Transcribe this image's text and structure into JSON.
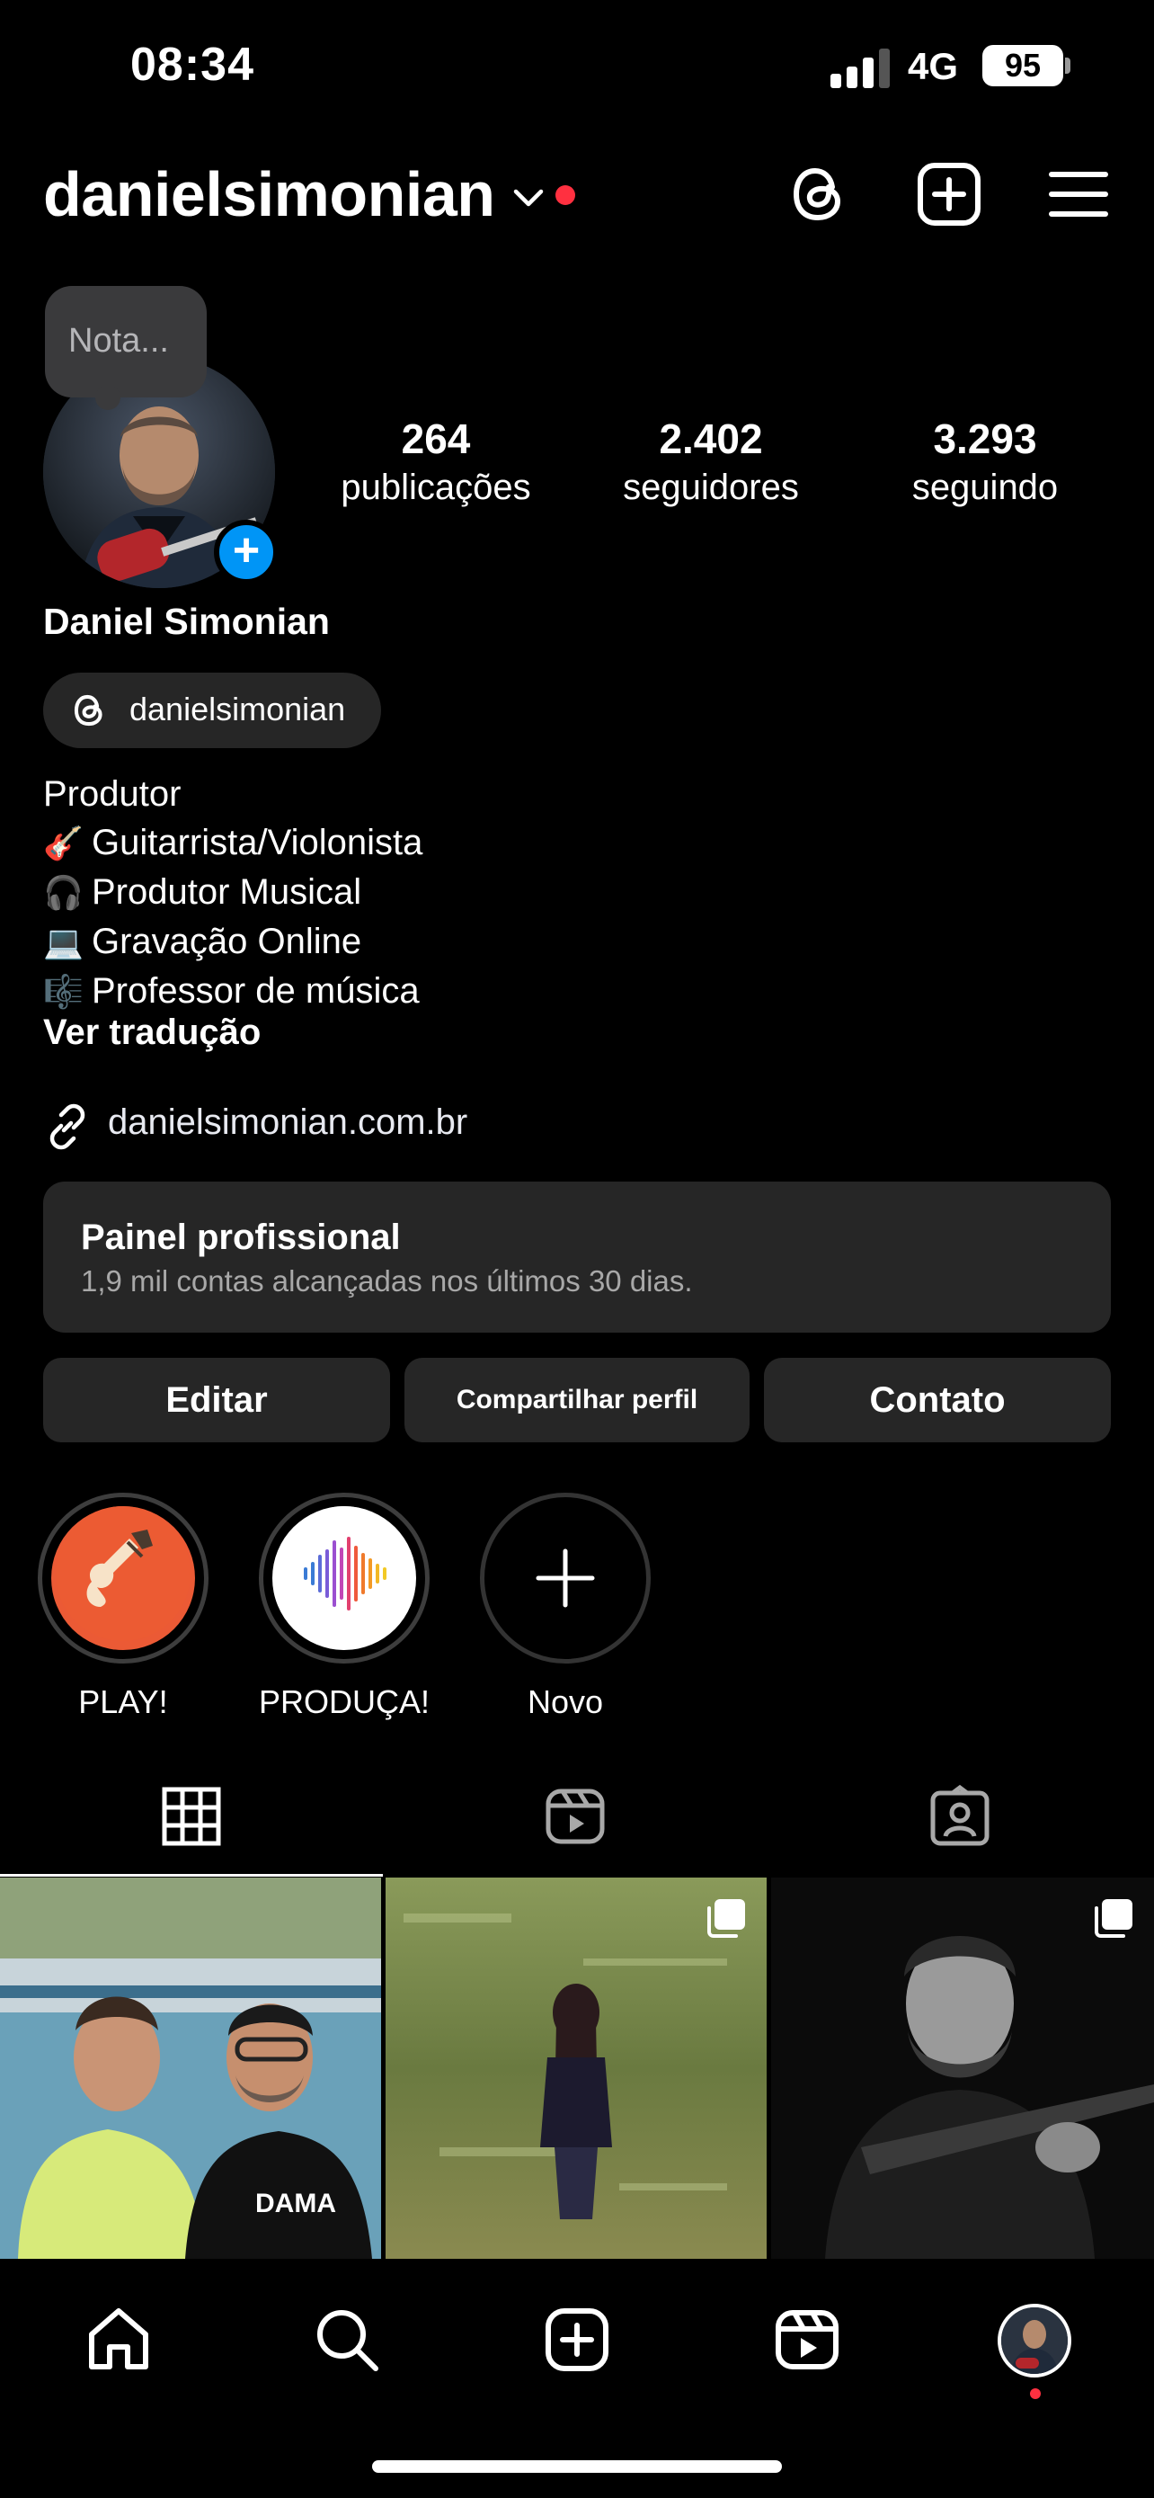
{
  "status_bar": {
    "time": "08:34",
    "network": "4G",
    "battery": "95"
  },
  "header": {
    "username": "danielsimonian"
  },
  "profile": {
    "note_placeholder": "Nota...",
    "stats": [
      {
        "value": "264",
        "label": "publicações"
      },
      {
        "value": "2.402",
        "label": "seguidores"
      },
      {
        "value": "3.293",
        "label": "seguindo"
      }
    ],
    "full_name": "Daniel Simonian",
    "threads_handle": "danielsimonian",
    "bio_lines": [
      {
        "emoji": "",
        "text": "Produtor"
      },
      {
        "emoji": "🎸",
        "text": "Guitarrista/Violonista"
      },
      {
        "emoji": "🎧",
        "text": "Produtor Musical"
      },
      {
        "emoji": "💻",
        "text": "Gravação Online"
      },
      {
        "emoji": "🎼",
        "text": "Professor de música"
      }
    ],
    "see_translation": "Ver tradução",
    "link": "danielsimonian.com.br"
  },
  "panel": {
    "title": "Painel profissional",
    "subtitle": "1,9 mil contas alcançadas nos últimos 30 dias."
  },
  "actions": {
    "edit": "Editar",
    "share": "Compartilhar perfil",
    "contact": "Contato"
  },
  "highlights": [
    {
      "label": "PLAY!",
      "icon": "garageband-icon"
    },
    {
      "label": "PRODUÇA!",
      "icon": "waveform-icon"
    },
    {
      "label": "Novo",
      "icon": "plus-icon"
    }
  ],
  "tabs": [
    "grid-icon",
    "reels-icon",
    "tagged-icon"
  ],
  "nav": [
    "home-icon",
    "search-icon",
    "create-icon",
    "reels-icon",
    "profile-avatar"
  ],
  "colors": {
    "accent_blue": "#0095f6",
    "notification_red": "#ff3040",
    "surface": "#262626"
  }
}
